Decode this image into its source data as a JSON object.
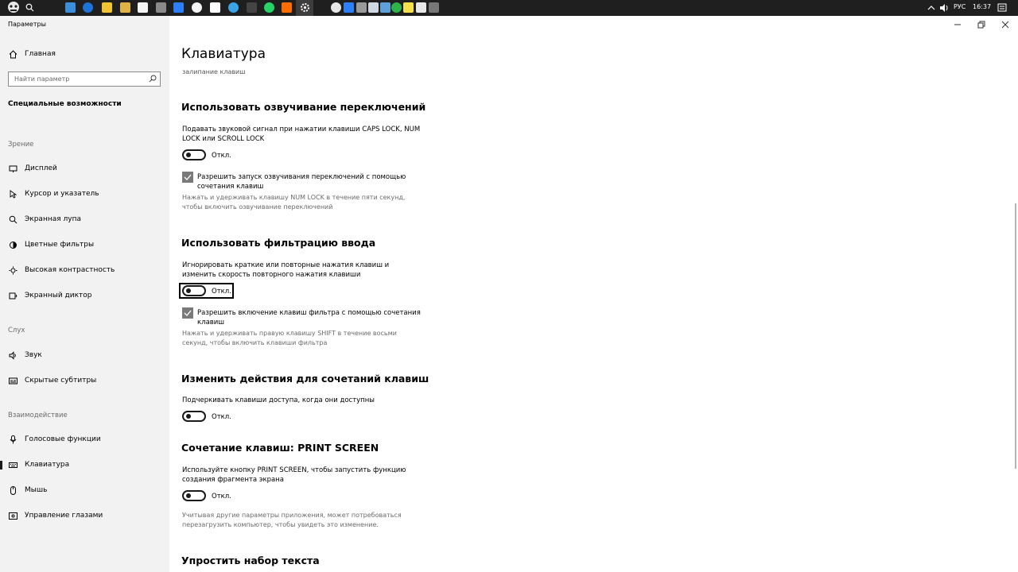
{
  "taskbar": {
    "language": "РУС",
    "time": "16:37",
    "accent_colors": [
      "#3b8edb",
      "#1e73d8",
      "#f1c232",
      "#f5f5f5",
      "#f5f5f5",
      "#2d7ff9",
      "#f5f5f5",
      "#ffffff",
      "#3ba4e8",
      "#ffffff",
      "#25d366",
      "#ff6d00",
      "#9a9a9a"
    ]
  },
  "window": {
    "app_title": "Параметры",
    "minimize_icon": "minimize-icon",
    "restore_icon": "restore-icon",
    "close_icon": "close-icon"
  },
  "sidebar": {
    "home_label": "Главная",
    "search_placeholder": "Найти параметр",
    "section_label": "Специальные возможности",
    "groups": [
      {
        "heading": "Зрение",
        "items": [
          {
            "label": "Дисплей",
            "icon": "display-icon"
          },
          {
            "label": "Курсор и указатель",
            "icon": "cursor-icon"
          },
          {
            "label": "Экранная лупа",
            "icon": "magnifier-icon"
          },
          {
            "label": "Цветные фильтры",
            "icon": "color-filter-icon"
          },
          {
            "label": "Высокая контрастность",
            "icon": "contrast-icon"
          },
          {
            "label": "Экранный диктор",
            "icon": "narrator-icon"
          }
        ]
      },
      {
        "heading": "Слух",
        "items": [
          {
            "label": "Звук",
            "icon": "speaker-icon"
          },
          {
            "label": "Скрытые субтитры",
            "icon": "captions-icon"
          }
        ]
      },
      {
        "heading": "Взаимодействие",
        "items": [
          {
            "label": "Голосовые функции",
            "icon": "microphone-icon"
          },
          {
            "label": "Клавиатура",
            "icon": "keyboard-icon",
            "selected": true
          },
          {
            "label": "Мышь",
            "icon": "mouse-icon"
          },
          {
            "label": "Управление глазами",
            "icon": "eye-control-icon"
          }
        ]
      }
    ]
  },
  "content": {
    "title": "Клавиатура",
    "subtitle": "залипание клавиш",
    "toggle_sections": {
      "sticky": {
        "heading": "Использовать озвучивание переключений",
        "description": "Подавать звуковой сигнал при нажатии клавиши CAPS LOCK, NUM LOCK или SCROLL LOCK",
        "toggle_label": "Откл.",
        "toggle_on": false,
        "checkbox_label": "Разрешить запуск озвучивания переключений с помощью сочетания клавиш",
        "checkbox_checked": true,
        "hint": "Нажать и удерживать клавишу NUM LOCK в течение пяти секунд, чтобы включить озвучивание переключений"
      },
      "filter": {
        "heading": "Использовать фильтрацию ввода",
        "description": "Игнорировать краткие или повторные нажатия клавиш и изменить скорость повторного нажатия клавиши",
        "toggle_label": "Откл.",
        "toggle_on": false,
        "checkbox_label": "Разрешить включение клавиш фильтра с помощью сочетания клавиш",
        "checkbox_checked": true,
        "hint": "Нажать и удерживать правую клавишу SHIFT в течение восьми секунд, чтобы включить клавиши фильтра"
      },
      "shortcuts": {
        "heading": "Изменить действия для сочетаний клавиш",
        "description": "Подчеркивать клавиши доступа, когда они доступны",
        "toggle_label": "Откл.",
        "toggle_on": false
      },
      "printscreen": {
        "heading": "Сочетание клавиш: PRINT SCREEN",
        "description": "Используйте кнопку PRINT SCREEN, чтобы запустить функцию создания фрагмента экрана",
        "toggle_label": "Откл.",
        "toggle_on": false,
        "hint": "Учитывая другие параметры приложения, может потребоваться перезагрузить компьютер, чтобы увидеть это изменение."
      }
    },
    "next_heading": "Упростить набор текста"
  }
}
